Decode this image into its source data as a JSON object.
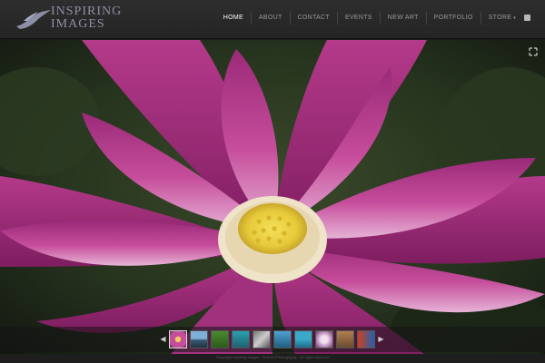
{
  "brand": {
    "line1": "INSPIRING",
    "line2": "IMAGES"
  },
  "nav": {
    "items": [
      {
        "label": "HOME",
        "active": true
      },
      {
        "label": "ABOUT"
      },
      {
        "label": "CONTACT"
      },
      {
        "label": "EVENTS"
      },
      {
        "label": "NEW ART"
      },
      {
        "label": "PORTFOLIO"
      },
      {
        "label": "STORE"
      }
    ],
    "caret": "▾"
  },
  "slideshow": {
    "prev": "◀",
    "next": "▶",
    "thumb_count": 10,
    "active_thumb": 1
  },
  "footer": {
    "text": "Copyright Inspiring Images · Fine Art Photography · All rights reserved"
  },
  "colors": {
    "header_bg": "#282828",
    "accent": "#d9338f",
    "nav_active": "#ffffff"
  }
}
